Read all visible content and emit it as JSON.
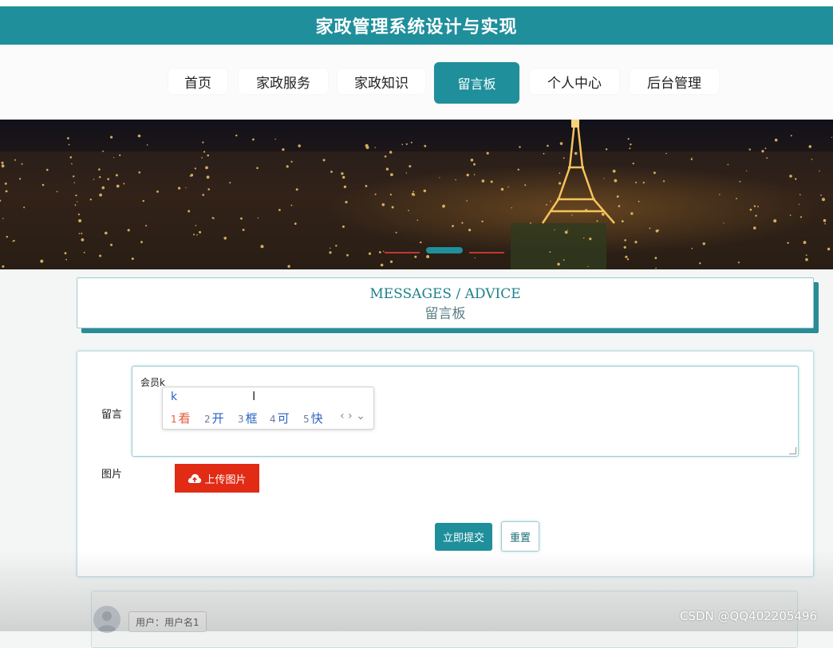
{
  "app": {
    "title": "家政管理系统设计与实现"
  },
  "nav": {
    "items": [
      {
        "label": "首页"
      },
      {
        "label": "家政服务"
      },
      {
        "label": "家政知识"
      },
      {
        "label": "留言板",
        "active": true
      },
      {
        "label": "个人中心"
      },
      {
        "label": "后台管理"
      }
    ]
  },
  "section": {
    "title_en": "MESSAGES / ADVICE",
    "title_cn": "留言板"
  },
  "form": {
    "message_label": "留言",
    "message_value": "会员k",
    "image_label": "图片",
    "upload_label": "上传图片",
    "submit_label": "立即提交",
    "reset_label": "重置"
  },
  "ime": {
    "input": "k",
    "candidates": [
      {
        "n": "1",
        "text": "看"
      },
      {
        "n": "2",
        "text": "开"
      },
      {
        "n": "3",
        "text": "框"
      },
      {
        "n": "4",
        "text": "可"
      },
      {
        "n": "5",
        "text": "快"
      }
    ],
    "arrows": "‹ › ⌄"
  },
  "message_list": {
    "user_tag": "用户：用户名1"
  },
  "watermark": "CSDN @QQ402205496",
  "colors": {
    "primary": "#1f8f9b",
    "upload": "#e12b14"
  }
}
